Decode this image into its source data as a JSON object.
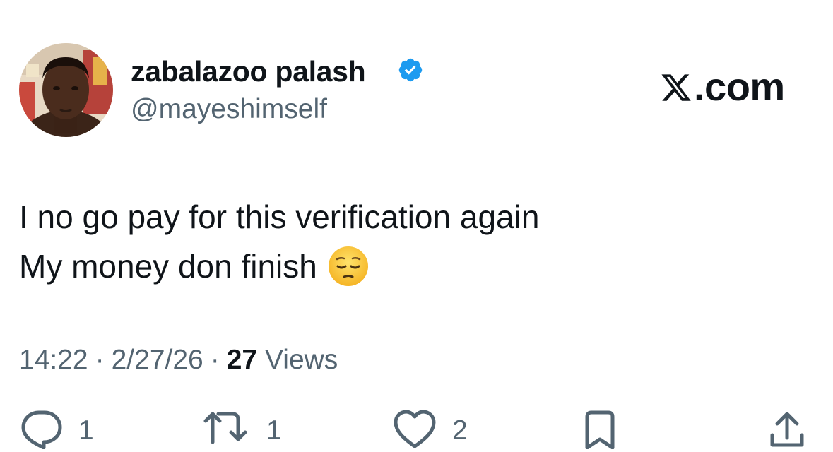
{
  "author": {
    "display_name": "zabalazoo palash",
    "handle": "@mayeshimself",
    "verified": true,
    "avatar": "profile-photo"
  },
  "brand": {
    "label": ".com",
    "logo_icon": "x-logo-icon"
  },
  "tweet": {
    "lines": [
      "I no go pay for this verification again",
      "My money don finish"
    ],
    "emoji": "pensive-face-emoji"
  },
  "meta": {
    "time": "14:22",
    "separator": "·",
    "date": "2/27/26",
    "views_count": "27",
    "views_label": "Views"
  },
  "actions": {
    "replies": "1",
    "reposts": "1",
    "likes": "2",
    "bookmark_icon": "bookmark-icon",
    "share_icon": "share-icon"
  },
  "colors": {
    "text_primary": "#0f1419",
    "text_secondary": "#536471",
    "verified_blue": "#1d9bf0"
  }
}
